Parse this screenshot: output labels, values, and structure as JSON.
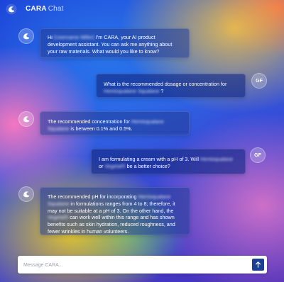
{
  "header": {
    "brand": "CARA",
    "subtitle": "Chat"
  },
  "messages": [
    {
      "role": "assistant",
      "parts": [
        "Hi ",
        "(Username Miller)",
        " I'm CARA, your AI product development assistant. You can ask me anything about your raw materials. What would you like to know?"
      ]
    },
    {
      "role": "user",
      "initials": "GF",
      "parts": [
        "What is the recommended dosage or concentration for ",
        "Hemisqualane Squalane",
        " ?"
      ]
    },
    {
      "role": "assistant",
      "parts": [
        "The recommended concentration for ",
        "Hemisqualane Squalane",
        " is between 0.1% and 0.5%."
      ]
    },
    {
      "role": "user",
      "initials": "GF",
      "parts": [
        "I am formulating a cream with a pH of 3. Will ",
        "Hemisqualane",
        " or ",
        "Vegetal®",
        " be a better choice?"
      ]
    },
    {
      "role": "assistant",
      "parts": [
        "The recommended pH for incorporating ",
        "Hemisqualane Squalane",
        " in formulations ranges from 4 to 8; therefore, it may not be suitable at a pH of 3. On the other hand, the ",
        "Vegetal®",
        " can work well within this range and has shown benefits such as skin hydration, reduced roughness, and fewer wrinkles in human volunteers."
      ]
    }
  ],
  "composer": {
    "placeholder": "Message CARA..."
  },
  "icons": {
    "logo": "cara-logo-icon",
    "bot": "cara-bot-icon",
    "send": "arrow-up-icon"
  }
}
